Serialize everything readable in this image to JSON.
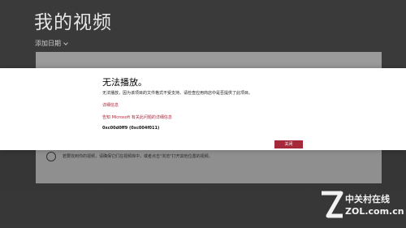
{
  "page": {
    "title": "我的视频",
    "sort_label": "添加日期"
  },
  "panel": {
    "hint_text": "若要找到你的视频，请确保它们在视频库中，或者点击\"浏览\"打开其他位置的视频。"
  },
  "dialog": {
    "title": "无法播放。",
    "message": "无法播放，因为该项目的文件格式不受支持。请检查应用商店中是否提供了此项目。",
    "details_link": "详细信息",
    "tell_link": "告知 Microsoft 有关此问题的详细信息",
    "error_code": "0xc00d0ff9 (0xc004f011)",
    "close_label": "关闭"
  },
  "watermark": {
    "name": "中关村在线",
    "domain": "ZOL.com.cn"
  },
  "colors": {
    "accent": "#a5283b",
    "link": "#b0263b",
    "backdrop": "#3a3a3a",
    "panel": "#9a9a9a"
  }
}
